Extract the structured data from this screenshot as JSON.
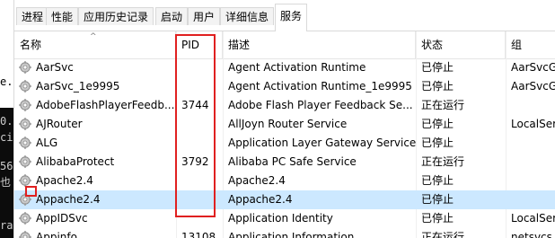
{
  "background_text": {
    "light_lines": [
      "",
      "",
      "",
      "e.p",
      "",
      "",
      ""
    ],
    "dark_lines": [
      "0.",
      "ci",
      "",
      "56",
      "也",
      "",
      "ra",
      ""
    ]
  },
  "tabs": [
    {
      "label": "进程"
    },
    {
      "label": "性能"
    },
    {
      "label": "应用历史记录"
    },
    {
      "label": "启动"
    },
    {
      "label": "用户"
    },
    {
      "label": "详细信息"
    },
    {
      "label": "服务"
    }
  ],
  "columns": {
    "name": "名称",
    "pid": "PID",
    "description": "描述",
    "status": "状态",
    "group": "组"
  },
  "services": [
    {
      "name": "AarSvc",
      "pid": "",
      "description": "Agent Activation Runtime",
      "status": "已停止",
      "group": "AarSvcGr"
    },
    {
      "name": "AarSvc_1e9995",
      "pid": "",
      "description": "Agent Activation Runtime_1e9995",
      "status": "已停止",
      "group": "AarSvcGr"
    },
    {
      "name": "AdobeFlashPlayerFeedb...",
      "pid": "3744",
      "description": "Adobe Flash Player Feedback Se...",
      "status": "正在运行",
      "group": ""
    },
    {
      "name": "AJRouter",
      "pid": "",
      "description": "AllJoyn Router Service",
      "status": "已停止",
      "group": "LocalSer"
    },
    {
      "name": "ALG",
      "pid": "",
      "description": "Application Layer Gateway Service",
      "status": "已停止",
      "group": ""
    },
    {
      "name": "AlibabaProtect",
      "pid": "3792",
      "description": "Alibaba PC Safe Service",
      "status": "正在运行",
      "group": ""
    },
    {
      "name": "Apache2.4",
      "pid": "",
      "description": "Apache2.4",
      "status": "已停止",
      "group": ""
    },
    {
      "name": "Appache2.4",
      "pid": "",
      "description": "Appache2.4",
      "status": "已停止",
      "group": ""
    },
    {
      "name": "AppIDSvc",
      "pid": "",
      "description": "Application Identity",
      "status": "已停止",
      "group": "LocalSer"
    },
    {
      "name": "Appinfo",
      "pid": "13108",
      "description": "Application Information",
      "status": "正在运行",
      "group": "netsvcs"
    }
  ],
  "selected_row_index": 7,
  "colors": {
    "selected_row": "#cce8ff",
    "highlight_box": "#e02020"
  }
}
